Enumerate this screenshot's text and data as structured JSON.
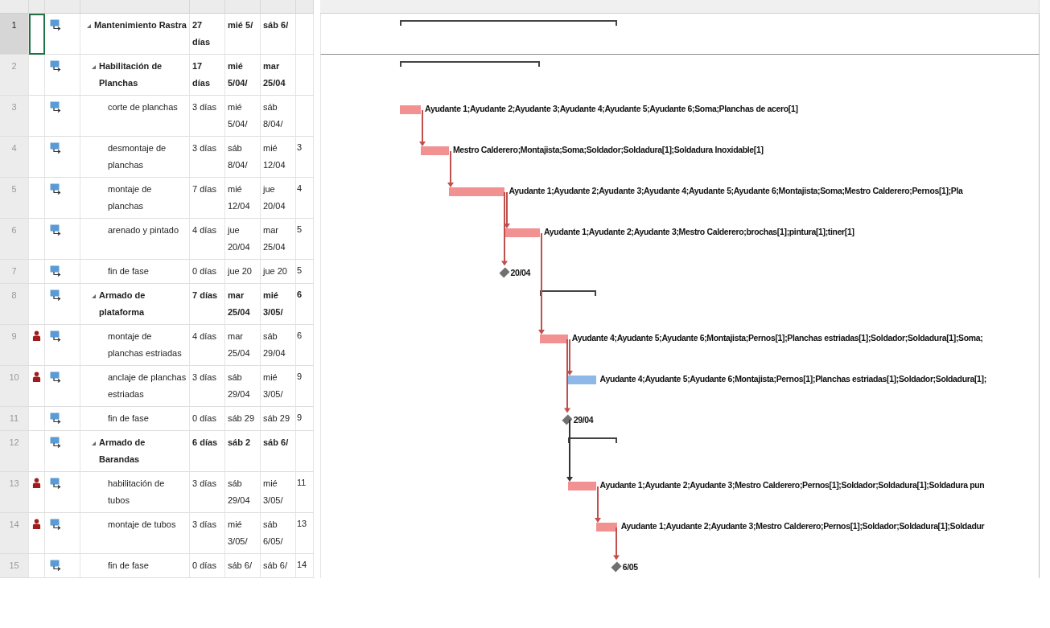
{
  "tasks": [
    {
      "id": "1",
      "selected": true,
      "resource_indicator": false,
      "expanded": true,
      "name": "Mantenimiento Rastra",
      "duration": "27 días",
      "start": "mié 5/",
      "finish": "sáb 6/",
      "bar": {
        "kind": "summary"
      },
      "children": [
        {
          "id": "2",
          "selected": false,
          "resource_indicator": false,
          "expanded": true,
          "name": "Habilitación de Planchas",
          "duration": "17 días",
          "start": "mié 5/04/",
          "finish": "mar 25/04",
          "bar": {
            "kind": "summary"
          },
          "children": [
            {
              "id": "3",
              "selected": false,
              "resource_indicator": false,
              "name": "corte de planchas",
              "duration": "3 días",
              "start": "mié 5/04/",
              "finish": "sáb 8/04/",
              "bar": {
                "kind": "task",
                "color": "#f29191",
                "label": "Ayudante 1;Ayudante 2;Ayudante 3;Ayudante 4;Ayudante 5;Ayudante 6;Soma;Planchas de acero[1]"
              }
            },
            {
              "id": "4",
              "selected": false,
              "resource_indicator": false,
              "name": "desmontaje de planchas",
              "duration": "3 días",
              "start": "sáb 8/04/",
              "finish": "mié 12/04",
              "predecessors": "3",
              "link": {
                "color": "#c0504d"
              },
              "bar": {
                "kind": "task",
                "color": "#f29191",
                "label": "Mestro Calderero;Montajista;Soma;Soldador;Soldadura[1];Soldadura Inoxidable[1]"
              }
            },
            {
              "id": "5",
              "selected": false,
              "resource_indicator": false,
              "name": "montaje de planchas",
              "duration": "7 días",
              "start": "mié 12/04",
              "finish": "jue 20/04",
              "predecessors": "4",
              "link": {
                "color": "#c0504d"
              },
              "bar": {
                "kind": "task",
                "color": "#f29191",
                "label": "Ayudante 1;Ayudante 2;Ayudante 3;Ayudante 4;Ayudante 5;Ayudante 6;Montajista;Soma;Mestro Calderero;Pernos[1];Pla"
              }
            },
            {
              "id": "6",
              "selected": false,
              "resource_indicator": false,
              "name": "arenado y pintado",
              "duration": "4 días",
              "start": "jue 20/04",
              "finish": "mar 25/04",
              "predecessors": "5",
              "link": {
                "color": "#c0504d"
              },
              "bar": {
                "kind": "task",
                "color": "#f29191",
                "label": "Ayudante 1;Ayudante 2;Ayudante 3;Mestro Calderero;brochas[1];pintura[1];tiner[1]"
              }
            },
            {
              "id": "7",
              "selected": false,
              "resource_indicator": false,
              "name": "fin de fase",
              "duration": "0 días",
              "start": "jue 20",
              "finish": "jue 20",
              "predecessors": "5",
              "link": {
                "color": "#c0504d"
              },
              "bar": {
                "kind": "milestone",
                "label": "20/04"
              }
            }
          ]
        },
        {
          "id": "8",
          "selected": false,
          "resource_indicator": false,
          "expanded": true,
          "name": "Armado de plataforma",
          "duration": "7 días",
          "start": "mar 25/04",
          "finish": "mié 3/05/",
          "predecessors": "6",
          "bar": {
            "kind": "summary"
          },
          "children": [
            {
              "id": "9",
              "selected": false,
              "resource_indicator": true,
              "name": "montaje de planchas estriadas",
              "duration": "4 días",
              "start": "mar 25/04",
              "finish": "sáb 29/04",
              "predecessors": "6",
              "link": {
                "color": "#c0504d"
              },
              "bar": {
                "kind": "task",
                "color": "#f29191",
                "label": "Ayudante 4;Ayudante 5;Ayudante 6;Montajista;Pernos[1];Planchas estriadas[1];Soldador;Soldadura[1];Soma;"
              }
            },
            {
              "id": "10",
              "selected": false,
              "resource_indicator": true,
              "name": "anclaje de planchas estriadas",
              "duration": "3 días",
              "start": "sáb 29/04",
              "finish": "mié 3/05/",
              "predecessors": "9",
              "link": {
                "color": "#c0504d"
              },
              "bar": {
                "kind": "task",
                "color": "#8db8e8",
                "label": "Ayudante 4;Ayudante 5;Ayudante 6;Montajista;Pernos[1];Planchas estriadas[1];Soldador;Soldadura[1];"
              }
            },
            {
              "id": "11",
              "selected": false,
              "resource_indicator": false,
              "name": "fin de fase",
              "duration": "0 días",
              "start": "sáb 29",
              "finish": "sáb 29",
              "predecessors": "9",
              "link": {
                "color": "#c0504d"
              },
              "bar": {
                "kind": "milestone",
                "label": "29/04"
              }
            }
          ]
        },
        {
          "id": "12",
          "selected": false,
          "resource_indicator": false,
          "expanded": true,
          "name": "Armado de Barandas",
          "duration": "6 días",
          "start": "sáb 2",
          "finish": "sáb 6/",
          "bar": {
            "kind": "summary"
          },
          "children": [
            {
              "id": "13",
              "selected": false,
              "resource_indicator": true,
              "name": "habilitación de tubos",
              "duration": "3 días",
              "start": "sáb 29/04",
              "finish": "mié 3/05/",
              "predecessors": "11",
              "link": {
                "color": "#333333"
              },
              "bar": {
                "kind": "task",
                "color": "#f29191",
                "label": "Ayudante 1;Ayudante 2;Ayudante 3;Mestro Calderero;Pernos[1];Soldador;Soldadura[1];Soldadura pun"
              }
            },
            {
              "id": "14",
              "selected": false,
              "resource_indicator": true,
              "name": "montaje de tubos",
              "duration": "3 días",
              "start": "mié 3/05/",
              "finish": "sáb 6/05/",
              "predecessors": "13",
              "link": {
                "color": "#c0504d"
              },
              "bar": {
                "kind": "task",
                "color": "#f29191",
                "label": "Ayudante 1;Ayudante 2;Ayudante 3;Mestro Calderero;Pernos[1];Soldador;Soldadura[1];Soldadur"
              }
            },
            {
              "id": "15",
              "selected": false,
              "resource_indicator": false,
              "name": "fin de fase",
              "duration": "0 días",
              "start": "sáb 6/",
              "finish": "sáb 6/",
              "predecessors": "14",
              "link": {
                "color": "#c0504d"
              },
              "bar": {
                "kind": "milestone",
                "label": "6/05"
              }
            }
          ]
        }
      ]
    }
  ]
}
